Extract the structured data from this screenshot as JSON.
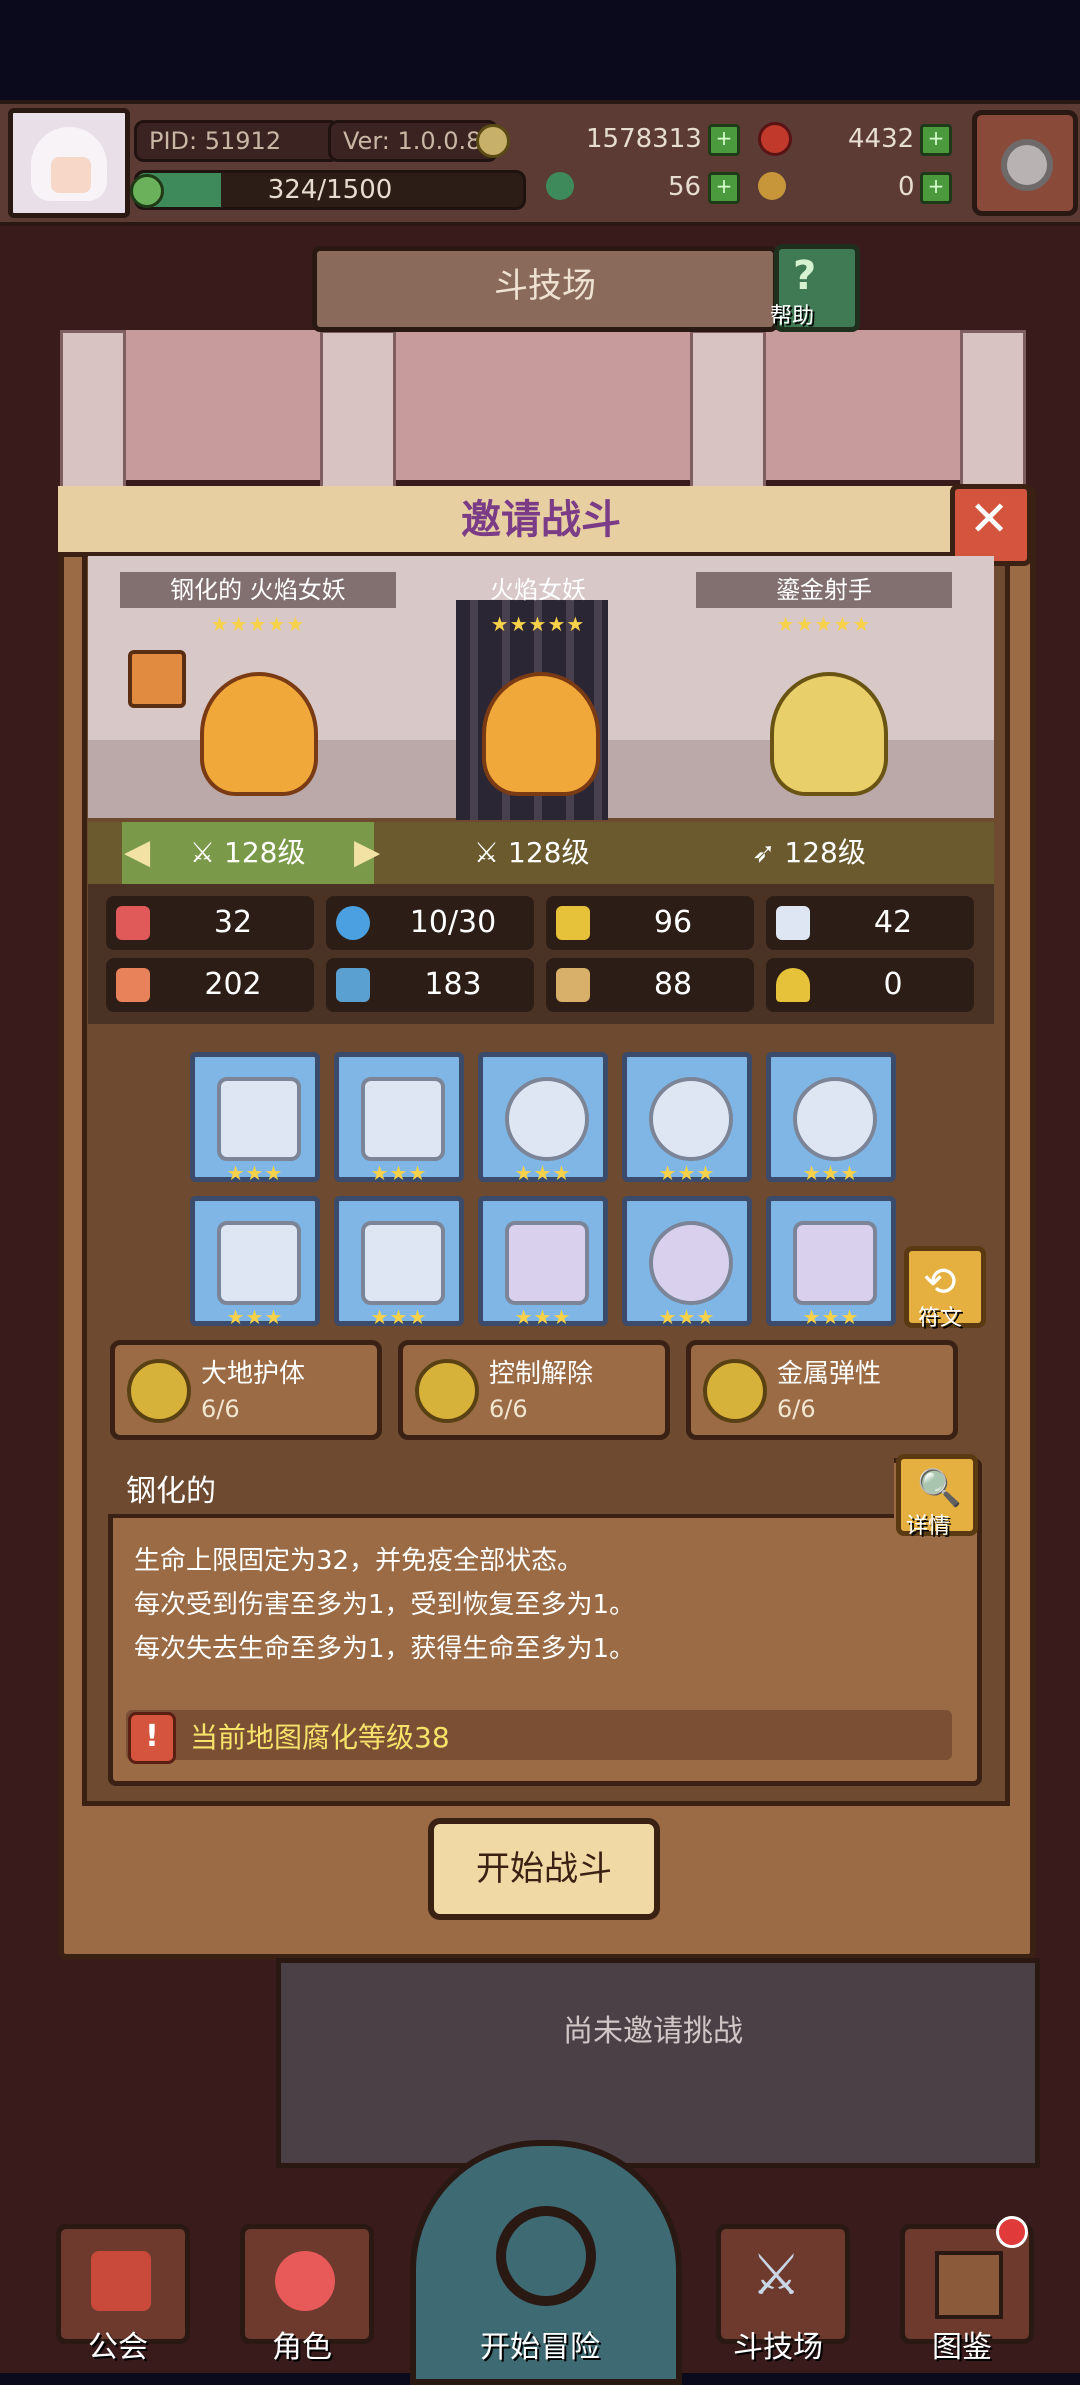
{
  "top_bar": {
    "pid": "PID: 51912",
    "version": "Ver: 1.0.0.8",
    "exp": "324/1500",
    "gold": "1578313",
    "gems": "4432",
    "clover": "56",
    "keys": "0"
  },
  "page_title": "斗技场",
  "help_label": "帮助",
  "modal": {
    "title": "邀请战斗",
    "heroes": [
      {
        "name": "钢化的 火焰女妖",
        "stars": "★★★★★",
        "level": "128级"
      },
      {
        "name": "火焰女妖",
        "stars": "★★★★★",
        "level": "128级"
      },
      {
        "name": "鎏金射手",
        "stars": "★★★★★",
        "level": "128级"
      }
    ],
    "stats": [
      {
        "icon": "heart-icon",
        "value": "32"
      },
      {
        "icon": "mana-drop-icon",
        "value": "10/30"
      },
      {
        "icon": "shield-icon",
        "value": "96"
      },
      {
        "icon": "wing-icon",
        "value": "42"
      },
      {
        "icon": "fist-icon",
        "value": "202"
      },
      {
        "icon": "book-icon",
        "value": "183"
      },
      {
        "icon": "scroll-icon",
        "value": "88"
      },
      {
        "icon": "horseshoe-icon",
        "value": "0"
      }
    ],
    "equipment_stars": "★★★",
    "rune_label": "符文",
    "traits": [
      {
        "name": "大地护体",
        "count": "6/6"
      },
      {
        "name": "控制解除",
        "count": "6/6"
      },
      {
        "name": "金属弹性",
        "count": "6/6"
      }
    ],
    "desc": {
      "title": "钢化的",
      "lines": [
        "生命上限固定为32，并免疫全部状态。",
        "每次受到伤害至多为1，受到恢复至多为1。",
        "每次失去生命至多为1，获得生命至多为1。"
      ],
      "detail_label": "详情",
      "warning": "当前地图腐化等级38"
    },
    "start_button": "开始战斗"
  },
  "not_invited": "尚未邀请挑战",
  "bottom_nav": {
    "guild": "公会",
    "character": "角色",
    "adventure": "开始冒险",
    "arena": "斗技场",
    "codex": "图鉴"
  },
  "colors": {
    "accent_purple": "#7a3c86",
    "panel_brown": "#6e4a31",
    "gold": "#f7d14a"
  }
}
